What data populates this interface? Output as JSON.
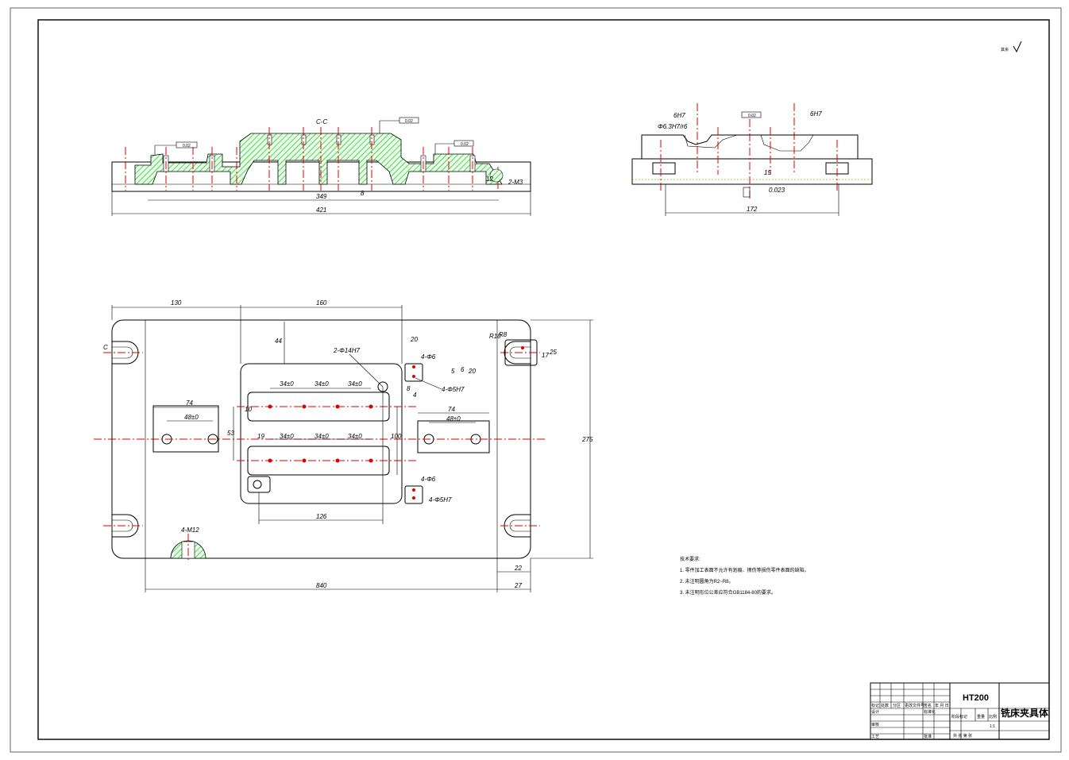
{
  "roughness_mark": "其余",
  "section_label": "C-C",
  "section_dims": {
    "d349": "349",
    "d421": "421",
    "d8": "8",
    "d12": "12",
    "d2m": "2-M3",
    "tol1": "0.02",
    "tol2": "0.02",
    "tol3": "0.02"
  },
  "side_dims": {
    "d172": "172",
    "fit_left": "6H7",
    "fit_left2": "Φ6.3H7/r6",
    "fit_right": "6H7",
    "d15": "15",
    "d93": "0.023",
    "tol": "0.02"
  },
  "plan_dims": {
    "d130": "130",
    "d160": "160",
    "d44": "44",
    "d20": "20",
    "hole_14": "2-Φ14H7",
    "hole_6a": "4-Φ6",
    "hole_5a": "4-Φ5H7",
    "d5": "5",
    "d6": "6",
    "d20b": "20",
    "d8": "8",
    "d4": "4",
    "r10": "R10",
    "r8": "R8",
    "d17": "17",
    "d25": "25",
    "d34_1": "34±0",
    "d34_2": "34±0",
    "d34_3": "34±0",
    "d34_4": "34±0",
    "d34_5": "34±0",
    "d34_6": "34±0",
    "d74a": "74",
    "d48a": "48±0",
    "d74b": "74",
    "d48b": "48±0",
    "d53": "53",
    "d100": "100",
    "d19": "19",
    "d10": "10",
    "hole_6b": "4-Φ6",
    "hole_5b": "4-Φ5H7",
    "d126": "126",
    "m12": "4-M12",
    "d275": "275",
    "d840": "840",
    "d22": "22",
    "d27": "27",
    "c_mark": "C"
  },
  "notes": {
    "title": "技术要求:",
    "line1": "1. 零件加工表面不允许有划痕、擦伤等损伤零件表面的缺陷。",
    "line2": "2. 未注明圆角为R2~R8。",
    "line3": "3. 未注明形位公差应符合GB1184-80的要求。"
  },
  "title_block": {
    "material": "HT200",
    "part_name": "铣床夹具体",
    "h_mark": "标记",
    "h_count": "处数",
    "h_zone": "分区",
    "h_doc": "更改文件号",
    "h_sign": "签名",
    "h_date": "年 月 日",
    "r_design": "设计",
    "r_std": "标准化",
    "r_stage": "阶段标记",
    "r_weight": "重量",
    "r_scale": "比例",
    "r_review": "审核",
    "r_craft": "工艺",
    "r_approve": "批准",
    "scale_val": "1:1",
    "sheet_info": "共 张 第 张"
  },
  "colors": {
    "hatch": "#00b000",
    "center_line": "#e00000",
    "line": "#000000"
  }
}
